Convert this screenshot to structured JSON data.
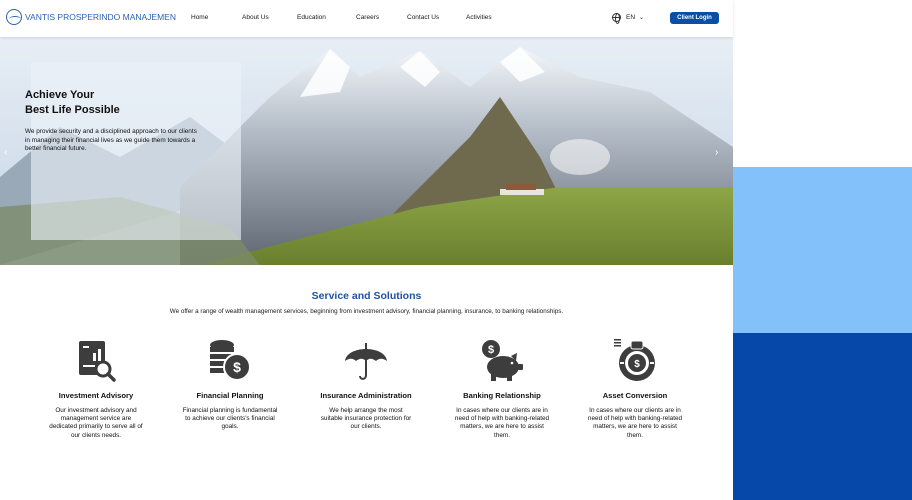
{
  "brand": {
    "name": "VANTIS PROSPERINDO MANAJEMEN"
  },
  "colors": {
    "primary": "#0b4ea6",
    "title_blue": "#1b54a7",
    "side_light": "#82c1fa",
    "side_dark": "#0548a9"
  },
  "nav": {
    "items": [
      "Home",
      "About Us",
      "Education",
      "Careers",
      "Contact Us",
      "Activities"
    ]
  },
  "language": {
    "value": "EN",
    "icon": "globe-icon"
  },
  "login": {
    "label": "Client Login"
  },
  "hero": {
    "title_line1": "Achieve Your",
    "title_line2": "Best Life Possible",
    "text": "We provide security and a disciplined approach to our clients in managing their financial lives as we guide them towards a better financial future.",
    "prev_icon": "chevron-left-icon",
    "next_icon": "chevron-right-icon"
  },
  "services": {
    "title": "Service and Solutions",
    "subtitle": "We offer a range of wealth management services, beginning from investment advisory, financial planning, insurance, to banking relationships.",
    "items": [
      {
        "icon": "report-magnifier-icon",
        "title": "Investment Advisory",
        "desc": "Our investment advisory and management service are dedicated primarily to serve all of our clients needs."
      },
      {
        "icon": "coins-dollar-icon",
        "title": "Financial Planning",
        "desc": "Financial planning is fundamental to achieve our clients's financial goals."
      },
      {
        "icon": "umbrella-icon",
        "title": "Insurance Administration",
        "desc": "We help arrange the most suitable insurance protection for our clients."
      },
      {
        "icon": "piggy-bank-icon",
        "title": "Banking Relationship",
        "desc": "In cases where our clients are in need of help with banking-related matters, we are here to assist them."
      },
      {
        "icon": "money-cycle-icon",
        "title": "Asset Conversion",
        "desc": "In cases where our clients are in need of help with banking-related matters, we are here to assist them."
      }
    ]
  }
}
